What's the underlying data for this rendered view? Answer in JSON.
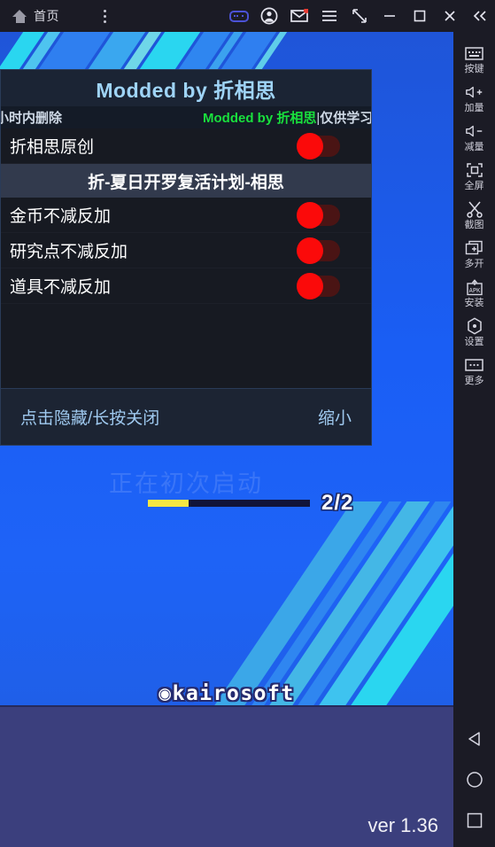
{
  "titlebar": {
    "home_label": "首页",
    "icons": [
      {
        "name": "gamepad-icon"
      },
      {
        "name": "account-icon"
      },
      {
        "name": "mail-icon"
      },
      {
        "name": "menu-icon"
      },
      {
        "name": "resize-icon"
      },
      {
        "name": "minimize-icon"
      },
      {
        "name": "maximize-icon"
      },
      {
        "name": "close-icon"
      },
      {
        "name": "collapse-icon"
      }
    ]
  },
  "toolbar": {
    "items": [
      {
        "label": "按键",
        "icon": "keyboard-icon"
      },
      {
        "label": "加量",
        "icon": "volume-up-icon"
      },
      {
        "label": "减量",
        "icon": "volume-down-icon"
      },
      {
        "label": "全屏",
        "icon": "fullscreen-icon"
      },
      {
        "label": "截图",
        "icon": "scissors-icon"
      },
      {
        "label": "多开",
        "icon": "multi-instance-icon"
      },
      {
        "label": "安装",
        "icon": "apk-install-icon"
      },
      {
        "label": "设置",
        "icon": "settings-icon"
      },
      {
        "label": "更多",
        "icon": "more-icon"
      }
    ],
    "nav": [
      {
        "name": "android-back-icon"
      },
      {
        "name": "android-home-icon"
      },
      {
        "name": "android-recents-icon"
      }
    ]
  },
  "mod_panel": {
    "title": "Modded by 折相思",
    "marquee_left": "小时内删除",
    "marquee_right_green": "Modded by 折相思",
    "marquee_sep": "|",
    "marquee_right_tail": "仅供学习交",
    "author_row": {
      "label": "折相思原创",
      "toggle_state": "off"
    },
    "section_title": "折-夏日开罗复活计划-相思",
    "options": [
      {
        "label": "金币不减反加",
        "toggle_state": "off"
      },
      {
        "label": "研究点不减反加",
        "toggle_state": "off"
      },
      {
        "label": "道具不减反加",
        "toggle_state": "off"
      }
    ],
    "footer": {
      "hint": "点击隐藏/长按关闭",
      "minimize": "缩小"
    }
  },
  "game": {
    "loading_text": "正在初次启动",
    "progress_label": "2/2",
    "progress_percent": 25,
    "logo": "◉kairosoft",
    "version": "ver 1.36"
  },
  "colors": {
    "accent_blue": "#1a5ef5",
    "toggle_off_knob": "#fb0a0a",
    "toggle_off_track": "#4a1414",
    "progress_fill": "#f5e642",
    "marquee_green": "#19e03d",
    "panel_bg": "#12151d",
    "titlebar_bg": "#1b1b25"
  }
}
